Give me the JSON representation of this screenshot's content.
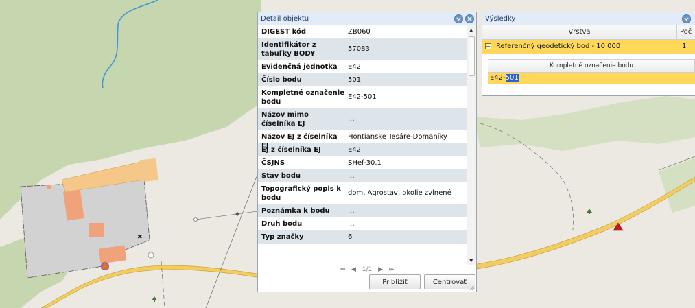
{
  "detail_panel": {
    "title": "Detail objektu",
    "rows": [
      {
        "label": "DIGEST kód",
        "value": "ZB060"
      },
      {
        "label": "Identifikátor z tabuľky BODY",
        "value": "57083"
      },
      {
        "label": "Evidenčná jednotka",
        "value": "E42"
      },
      {
        "label": "Číslo bodu",
        "value": "501"
      },
      {
        "label": "Kompletné označenie bodu",
        "value": "E42-501"
      },
      {
        "label": "Názov mimo číselníka EJ",
        "value": "..."
      },
      {
        "label": "Názov EJ z číselníka EJ",
        "value": "Hontianske Tesáre-Domaníky"
      },
      {
        "label": "EJ z číselníka EJ",
        "value": "E42"
      },
      {
        "label": "ČSJNS",
        "value": "SHef-30.1"
      },
      {
        "label": "Stav bodu",
        "value": "..."
      },
      {
        "label": "Topografický popis k bodu",
        "value": "dom, Agrostav, okolie zvlnené"
      },
      {
        "label": "Poznámka k bodu",
        "value": "..."
      },
      {
        "label": "Druh bodu",
        "value": "..."
      },
      {
        "label": "Typ značky",
        "value": "6"
      }
    ],
    "pager": {
      "first": "⏮",
      "prev": "◀",
      "page": "1/1",
      "next": "▶",
      "last": "⏭"
    },
    "zoom_button": "Priblížiť",
    "center_button": "Centrovať"
  },
  "results_panel": {
    "title": "Výsledky",
    "col_layer": "Vrstva",
    "col_count": "Poč",
    "row_layer": "Referenčný geodetický bod - 10 000",
    "row_count": "1",
    "expander": "−",
    "sub_header": "Kompletné označenie bodu",
    "sub_value_prefix": "E42-",
    "sub_value_selected": "501"
  },
  "colors": {
    "header_bg": "#e1ecf8",
    "row_alt": "#dde4ea",
    "selection_yellow": "#ffd85a",
    "map_forest": "#c6d6ae",
    "map_field": "#ecebe3",
    "road": "#f3cd61",
    "river": "#3f97d8",
    "marker_red": "#c41a1a"
  },
  "icons": [
    "collapse-icon",
    "close-icon",
    "tree-icon",
    "triangle-marker-icon",
    "resize-grip-icon"
  ]
}
